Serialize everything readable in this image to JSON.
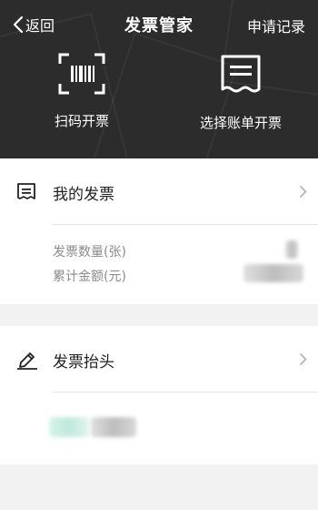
{
  "nav": {
    "back_label": "返回",
    "title": "发票管家",
    "records_label": "申请记录"
  },
  "actions": {
    "scan_label": "扫码开票",
    "bill_label": "选择账单开票"
  },
  "my_invoice": {
    "label": "我的发票",
    "count_label": "发票数量(张)",
    "amount_label": "累计金额(元)"
  },
  "invoice_heading": {
    "label": "发票抬头"
  },
  "icons": {
    "back": "chevron-left-icon",
    "scan": "barcode-scan-icon",
    "bill": "receipt-icon",
    "my_invoice": "invoice-icon",
    "heading": "pencil-icon",
    "chevron": "chevron-right-icon"
  },
  "colors": {
    "header_bg": "#2c2c2c",
    "page_bg": "#f2f2f2",
    "muted_text": "#8a8a8a"
  }
}
